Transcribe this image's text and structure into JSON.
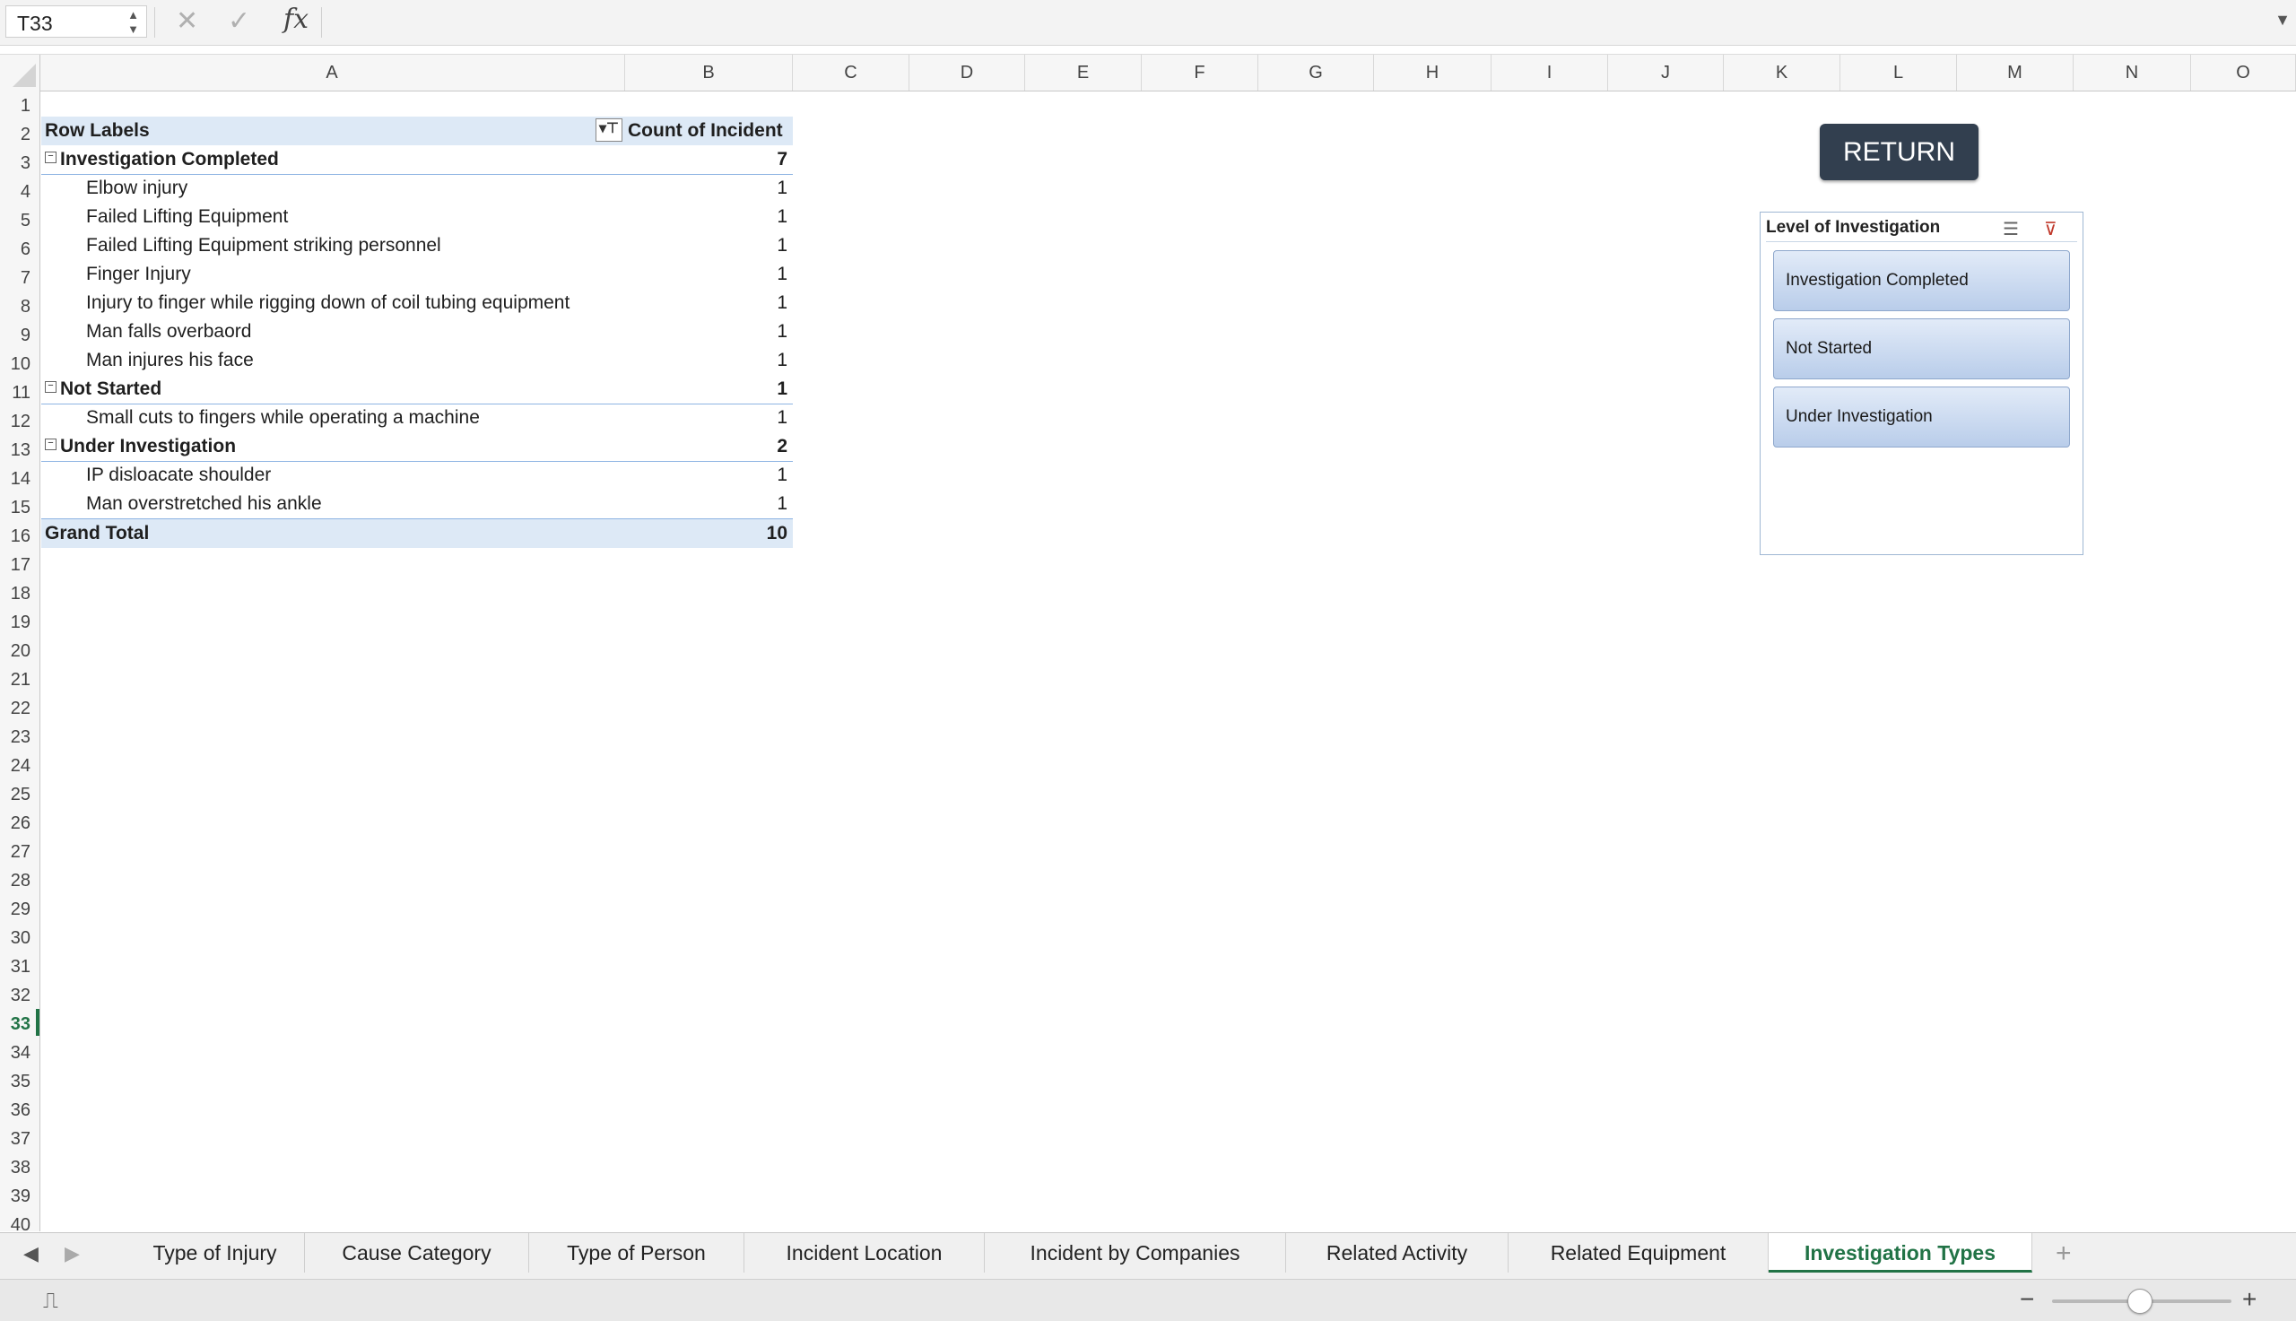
{
  "formula_bar": {
    "name_box": "T33",
    "cancel_icon": "x-icon",
    "confirm_icon": "check-icon",
    "fx_label": "fx",
    "formula": ""
  },
  "columns": [
    "A",
    "B",
    "C",
    "D",
    "E",
    "F",
    "G",
    "H",
    "I",
    "J",
    "K",
    "L",
    "M",
    "N",
    "O"
  ],
  "rows": [
    "1",
    "2",
    "3",
    "4",
    "5",
    "6",
    "7",
    "8",
    "9",
    "10",
    "11",
    "12",
    "13",
    "14",
    "15",
    "16",
    "17",
    "18",
    "19",
    "20",
    "21",
    "22",
    "23",
    "24",
    "25",
    "26",
    "27",
    "28",
    "29",
    "30",
    "31",
    "32",
    "33",
    "34",
    "35",
    "36",
    "37",
    "38",
    "39",
    "40"
  ],
  "active_row": "33",
  "pivot": {
    "header_label": "Row Labels",
    "header_count": "Count of Incident",
    "groups": [
      {
        "label": "Investigation Completed",
        "count": "7",
        "items": [
          {
            "label": "Elbow injury",
            "count": "1"
          },
          {
            "label": "Failed Lifting Equipment",
            "count": "1"
          },
          {
            "label": "Failed Lifting Equipment striking personnel",
            "count": "1"
          },
          {
            "label": "Finger Injury",
            "count": "1"
          },
          {
            "label": "Injury to finger while rigging down of coil tubing equipment",
            "count": "1"
          },
          {
            "label": "Man falls overbaord",
            "count": "1"
          },
          {
            "label": "Man injures his face",
            "count": "1"
          }
        ]
      },
      {
        "label": "Not Started",
        "count": "1",
        "items": [
          {
            "label": "Small cuts to fingers while operating a machine",
            "count": "1"
          }
        ]
      },
      {
        "label": "Under Investigation",
        "count": "2",
        "items": [
          {
            "label": "IP disloacate shoulder",
            "count": "1"
          },
          {
            "label": "Man overstretched his ankle",
            "count": "1"
          }
        ]
      }
    ],
    "total_label": "Grand Total",
    "total_count": "10"
  },
  "return_button": "RETURN",
  "slicer": {
    "title": "Level of Investigation",
    "items": [
      "Investigation Completed",
      "Not Started",
      "Under Investigation"
    ]
  },
  "sheet_tabs": [
    "Type of Injury",
    "Cause Category",
    "Type of Person",
    "Incident Location",
    "Incident by Companies",
    "Related Activity",
    "Related Equipment",
    "Investigation Types"
  ],
  "active_tab": "Investigation Types",
  "colors": {
    "accent": "#217346",
    "pivot_header": "#dde9f6",
    "return_button": "#323f4f",
    "slicer_item": "#c9d8ef"
  }
}
